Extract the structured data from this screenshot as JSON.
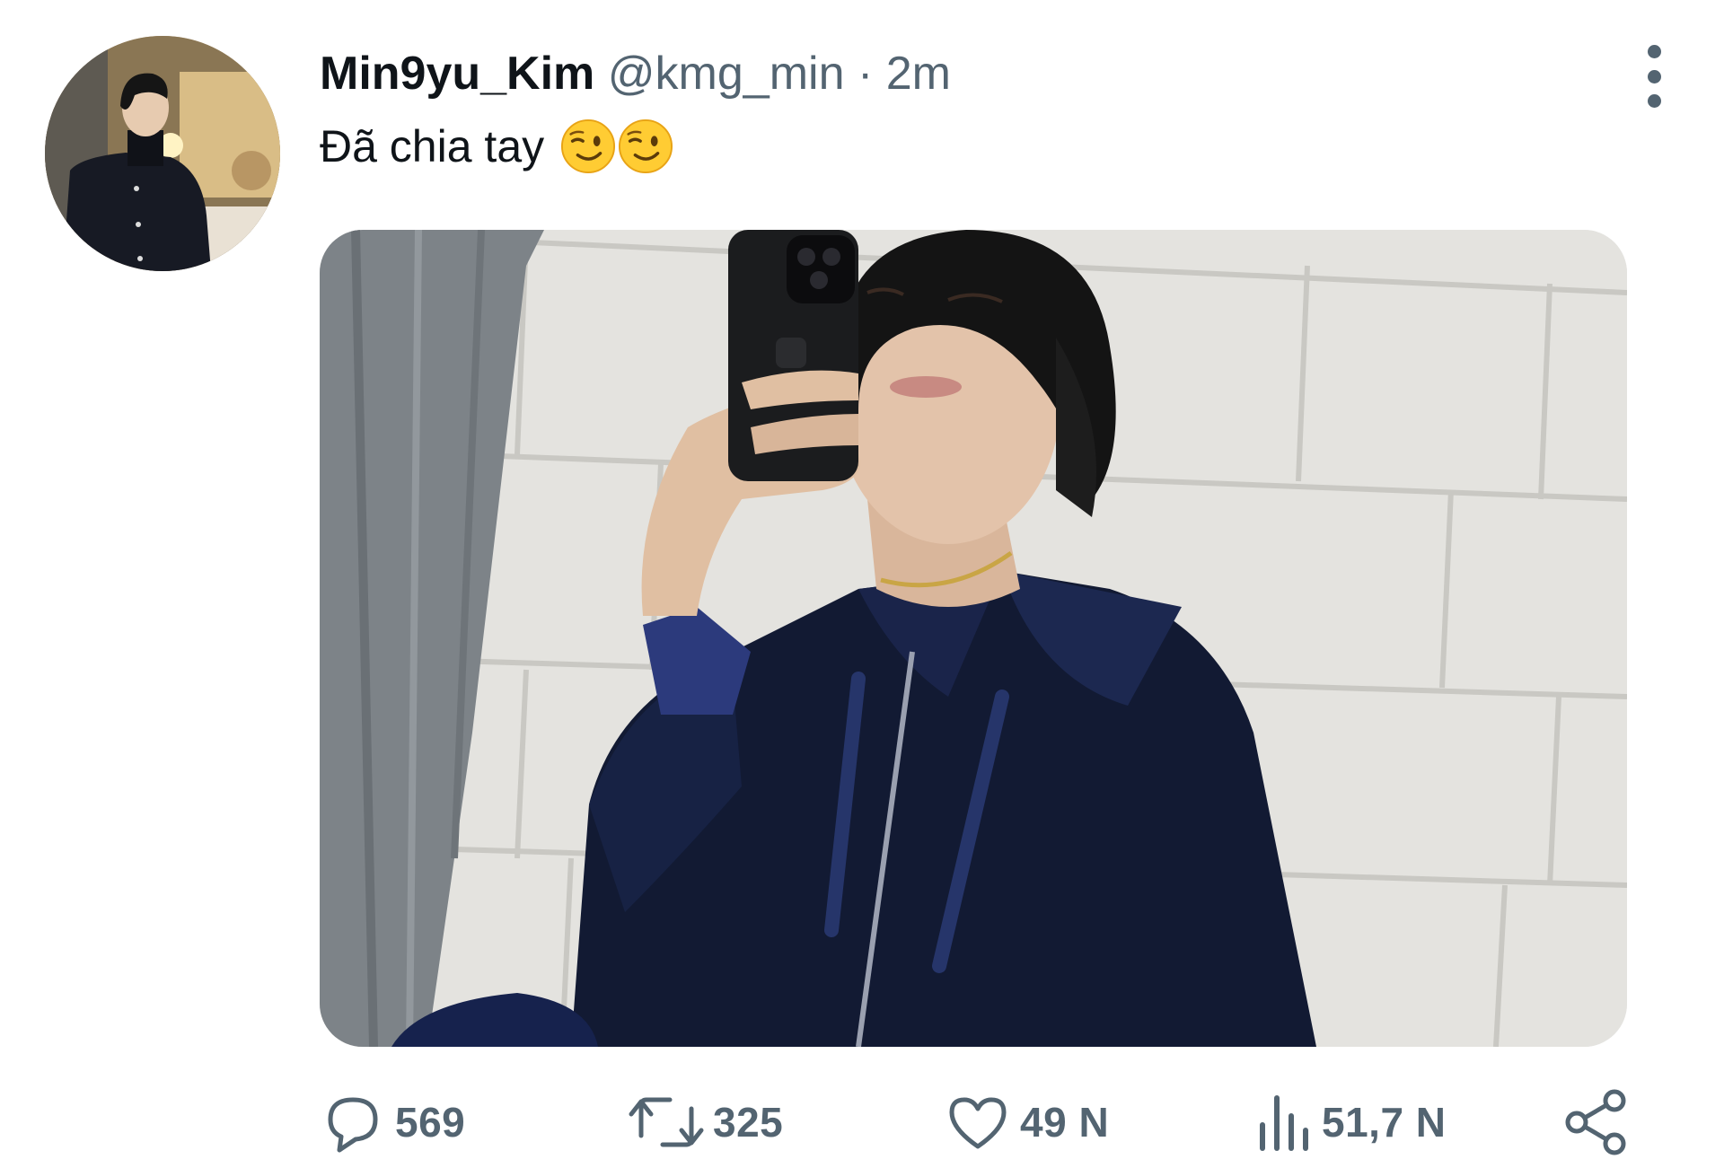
{
  "tweet": {
    "display_name": "Min9yu_Kim",
    "handle": "@kmg_min",
    "separator": "·",
    "time": "2m",
    "text": "Đã chia tay",
    "emojis": [
      "winking-face",
      "winking-face"
    ]
  },
  "menu": {
    "icon": "more-vertical-icon"
  },
  "actions": {
    "reply": {
      "icon": "reply-icon",
      "count": "569"
    },
    "retweet": {
      "icon": "retweet-icon",
      "count": "325"
    },
    "like": {
      "icon": "heart-icon",
      "count": "49 N"
    },
    "views": {
      "icon": "views-icon",
      "count": "51,7 N"
    },
    "share": {
      "icon": "share-icon"
    }
  },
  "colors": {
    "text_primary": "#0f1419",
    "text_secondary": "#536471",
    "background": "#ffffff"
  }
}
